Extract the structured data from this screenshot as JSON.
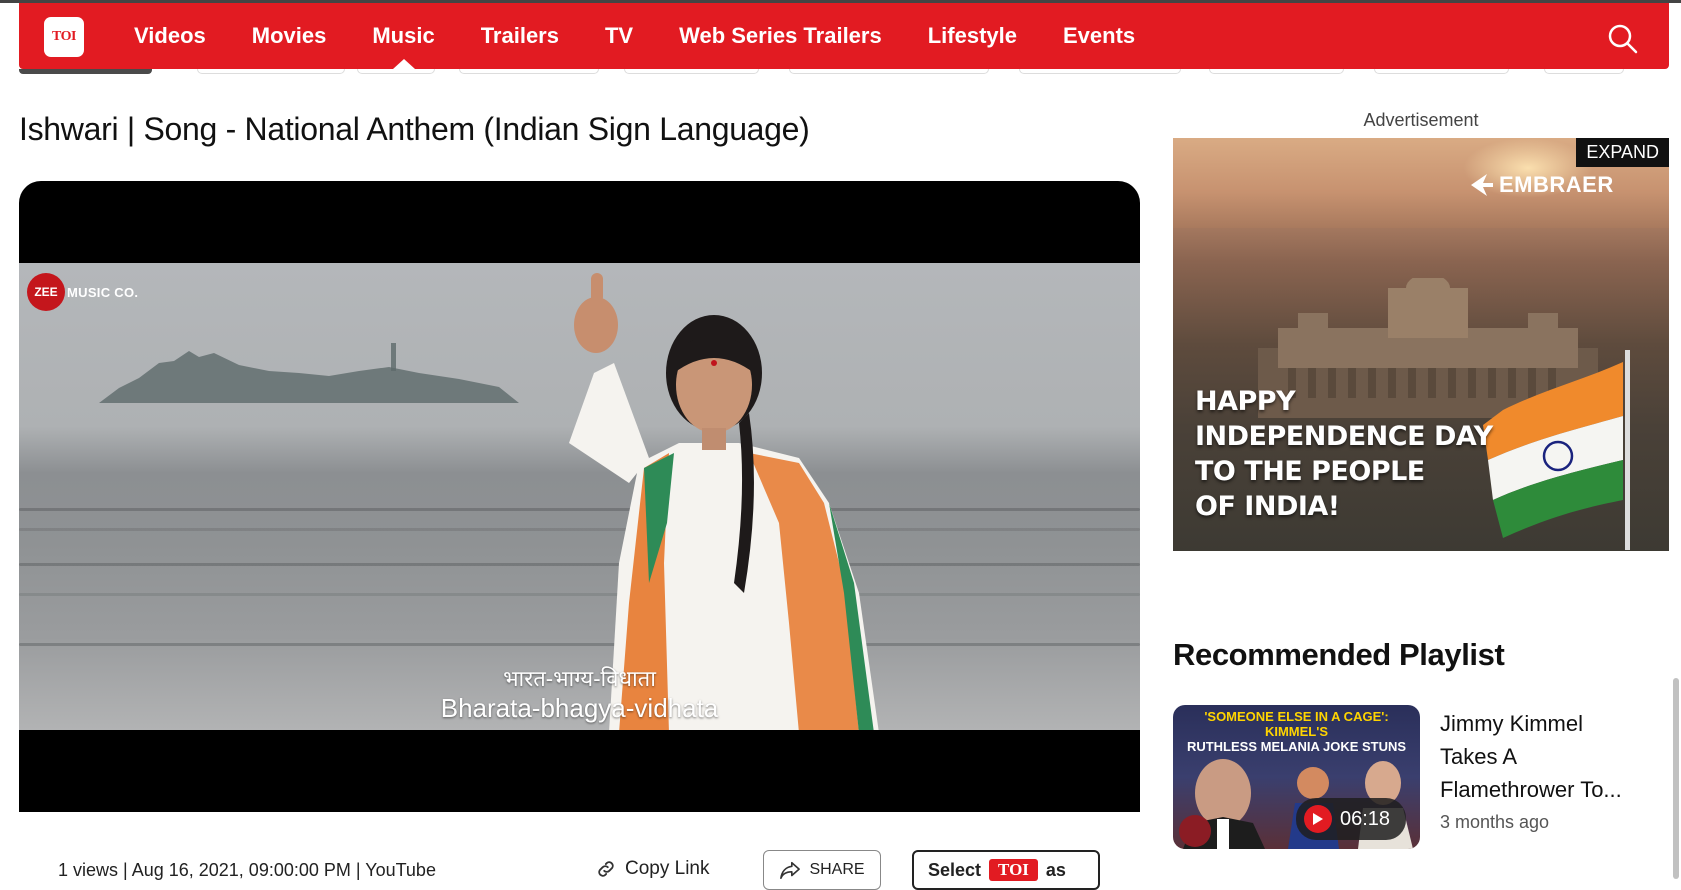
{
  "nav": {
    "logo": "TOI",
    "items": [
      {
        "label": "Videos"
      },
      {
        "label": "Movies"
      },
      {
        "label": "Music",
        "active": true
      },
      {
        "label": "Trailers"
      },
      {
        "label": "TV"
      },
      {
        "label": "Web Series Trailers"
      },
      {
        "label": "Lifestyle"
      },
      {
        "label": "Events"
      }
    ],
    "search_icon": "search-icon",
    "accent": "#e21b22"
  },
  "page": {
    "title": "Ishwari | Song - National Anthem (Indian Sign Language)"
  },
  "video": {
    "channel_logo_mark": "ZEE",
    "channel_logo_text": "MUSIC CO.",
    "caption_hindi": "भारत-भाग्य-विधाता",
    "caption_english": "Bharata-bhagya-vidhata"
  },
  "meta": {
    "info": "1 views | Aug 16, 2021, 09:00:00 PM | YouTube",
    "copy_link": "Copy Link",
    "share": "SHARE",
    "select_prefix": "Select",
    "select_brand": "TOI",
    "select_suffix": "as"
  },
  "ad": {
    "label": "Advertisement",
    "expand": "EXPAND",
    "brand": "EMBRAER",
    "headline_lines": [
      "HAPPY",
      "INDEPENDENCE DAY",
      "TO THE PEOPLE",
      "OF INDIA!"
    ]
  },
  "recommended": {
    "title": "Recommended Playlist",
    "items": [
      {
        "thumb_line1": "'SOMEONE ELSE IN A CAGE': KIMMEL'S",
        "thumb_line2": "RUTHLESS MELANIA JOKE STUNS",
        "duration": "06:18",
        "title_lines": [
          "Jimmy Kimmel",
          "Takes A",
          "Flamethrower To..."
        ],
        "time": "3 months ago"
      }
    ]
  }
}
